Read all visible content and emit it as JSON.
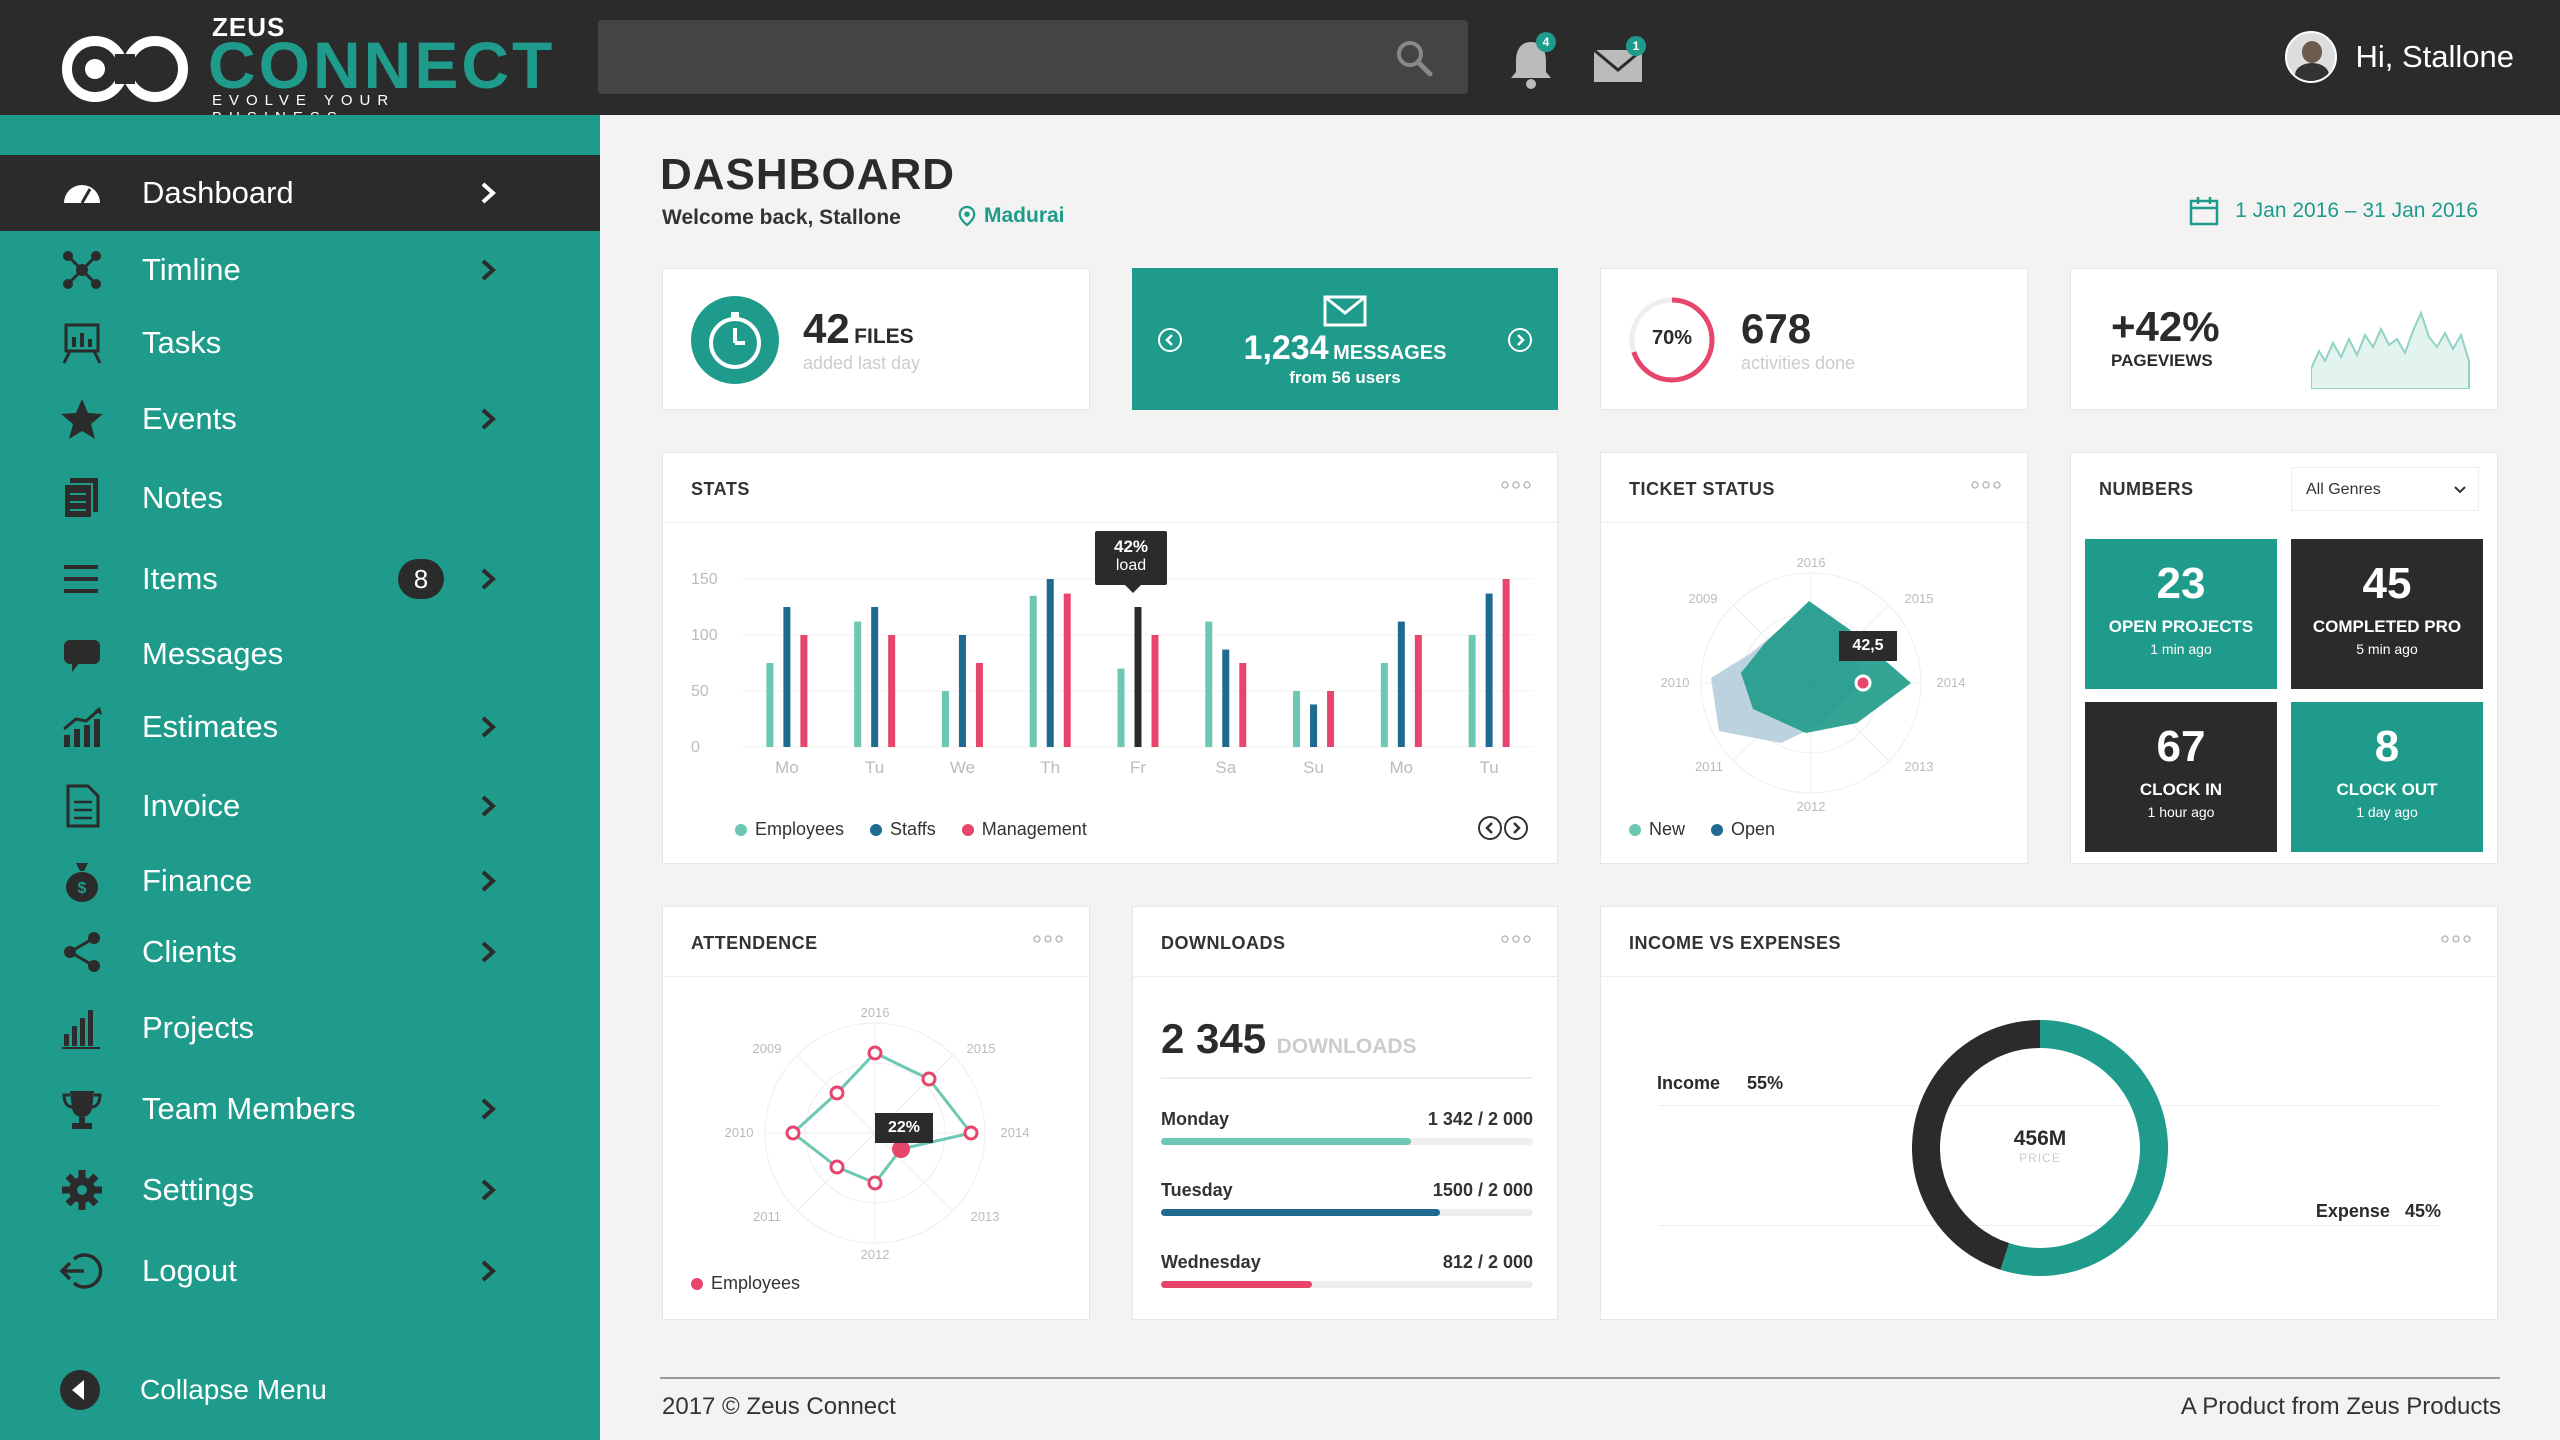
{
  "brand": {
    "top": "ZEUS",
    "name": "CONNECT",
    "tagline": "EVOLVE YOUR BUSINESS"
  },
  "header": {
    "notifications_count": "4",
    "messages_count": "1",
    "greeting": "Hi, Stallone"
  },
  "sidebar": {
    "items": [
      {
        "label": "Dashboard"
      },
      {
        "label": "Timline"
      },
      {
        "label": "Tasks"
      },
      {
        "label": "Events"
      },
      {
        "label": "Notes"
      },
      {
        "label": "Items",
        "badge": "8"
      },
      {
        "label": "Messages"
      },
      {
        "label": "Estimates"
      },
      {
        "label": "Invoice"
      },
      {
        "label": "Finance"
      },
      {
        "label": "Clients"
      },
      {
        "label": "Projects"
      },
      {
        "label": "Team Members"
      },
      {
        "label": "Settings"
      },
      {
        "label": "Logout"
      }
    ],
    "collapse_label": "Collapse Menu"
  },
  "page": {
    "title": "DASHBOARD",
    "welcome": "Welcome back, Stallone",
    "location": "Madurai",
    "date_range": "1 Jan 2016 – 31 Jan 2016"
  },
  "summary": {
    "files": {
      "value": "42",
      "unit": "FILES",
      "sub": "added last day"
    },
    "messages": {
      "value": "1,234",
      "unit": "MESSAGES",
      "sub": "from 56 users"
    },
    "activities": {
      "percent_label": "70%",
      "percent": 70,
      "value": "678",
      "sub": "activities done"
    },
    "pageviews": {
      "value": "+42%",
      "label": "PAGEVIEWS"
    }
  },
  "stats": {
    "title": "STATS",
    "tooltip": {
      "value": "42%",
      "label": "load"
    },
    "chart_data": {
      "type": "bar",
      "categories": [
        "Mo",
        "Tu",
        "We",
        "Th",
        "Fr",
        "Sa",
        "Su",
        "Mo",
        "Tu"
      ],
      "series": [
        {
          "name": "Employees",
          "values": [
            75,
            112,
            50,
            135,
            70,
            112,
            50,
            75,
            100
          ]
        },
        {
          "name": "Staffs",
          "values": [
            125,
            125,
            100,
            150,
            125,
            87,
            38,
            112,
            137
          ]
        },
        {
          "name": "Management",
          "values": [
            100,
            100,
            75,
            137,
            100,
            75,
            50,
            100,
            150
          ]
        }
      ],
      "ylim": [
        0,
        150
      ],
      "yticks": [
        "0",
        "50",
        "100",
        "150"
      ],
      "colors": [
        "#6cc7b3",
        "#1f6b8f",
        "#e8456d"
      ]
    }
  },
  "ticket": {
    "title": "TICKET STATUS",
    "tooltip": "42,5",
    "axes": [
      "2016",
      "2015",
      "2014",
      "2013",
      "2012",
      "2011",
      "2010",
      "2009"
    ],
    "legend": [
      "New",
      "Open"
    ]
  },
  "numbers": {
    "title": "NUMBERS",
    "filter": "All Genres",
    "tiles": [
      {
        "value": "23",
        "label": "OPEN PROJECTS",
        "sub": "1 min ago"
      },
      {
        "value": "45",
        "label": "COMPLETED PRO",
        "sub": "5 min ago"
      },
      {
        "value": "67",
        "label": "CLOCK IN",
        "sub": "1 hour ago"
      },
      {
        "value": "8",
        "label": "CLOCK OUT",
        "sub": "1 day ago"
      }
    ]
  },
  "attendence": {
    "title": "ATTENDENCE",
    "tooltip": "22%",
    "axes": [
      "2016",
      "2015",
      "2014",
      "2013",
      "2012",
      "2011",
      "2010",
      "2009"
    ],
    "legend": "Employees"
  },
  "downloads": {
    "title": "DOWNLOADS",
    "total": "2 345",
    "unit": "DOWNLOADS",
    "rows": [
      {
        "day": "Monday",
        "value_label": "1 342 / 2 000",
        "value": 1342,
        "max": 2000,
        "color": "#6cc7b3"
      },
      {
        "day": "Tuesday",
        "value_label": "1500 / 2 000",
        "value": 1500,
        "max": 2000,
        "color": "#1f6b8f"
      },
      {
        "day": "Wednesday",
        "value_label": "812 / 2 000",
        "value": 812,
        "max": 2000,
        "color": "#e8456d"
      }
    ]
  },
  "income": {
    "title": "INCOME VS EXPENSES",
    "center_value": "456M",
    "center_label": "PRICE",
    "income_label": "Income",
    "income_pct": "55%",
    "expense_label": "Expense",
    "expense_pct": "45%",
    "chart_data": {
      "type": "pie",
      "categories": [
        "Income",
        "Expense"
      ],
      "values": [
        55,
        45
      ],
      "colors": [
        "#1e9b8a",
        "#2b2b2b"
      ]
    }
  },
  "footer": {
    "left": "2017 © Zeus Connect",
    "right": "A Product from Zeus Products"
  }
}
